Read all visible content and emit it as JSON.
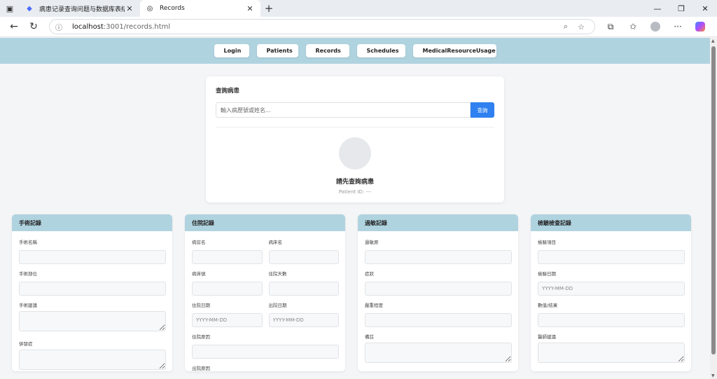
{
  "browser": {
    "tabs": [
      {
        "title": "病患记录查询问题与数据库表结构",
        "active": false,
        "icon": "deepseek-whale-icon"
      },
      {
        "title": "Records",
        "active": true,
        "icon": "globe-icon"
      }
    ],
    "url_host": "localhost",
    "url_path": ":3001/records.html"
  },
  "nav": {
    "login": "Login",
    "patients": "Patients",
    "records": "Records",
    "schedules": "Schedules",
    "medical_resource_usage": "MedicalResourceUsage"
  },
  "query": {
    "title": "查詢病患",
    "placeholder": "輸入病歷號或姓名...",
    "button": "查詢",
    "patient_name": "請先查詢病患",
    "patient_id": "Patient ID: ---"
  },
  "surgery": {
    "title": "手術記錄",
    "fields": {
      "name": "手術名稱",
      "site": "手術部位",
      "advice": "手術建議",
      "complication": "併發症"
    }
  },
  "admission": {
    "title": "住院記錄",
    "fields": {
      "ward": "病房名",
      "bed_name": "病床名",
      "bed_no": "病床號",
      "days": "住院天數",
      "admit_date": "住院日期",
      "discharge_date": "出院日期",
      "admit_reason": "住院原因",
      "discharge_reason": "出院原因"
    },
    "date_placeholder": "YYYY-MM-DD"
  },
  "allergy": {
    "title": "過敏記錄",
    "fields": {
      "allergen": "過敏原",
      "symptom": "症狀",
      "severity": "嚴重程度",
      "note": "備註"
    }
  },
  "exam": {
    "title": "檢驗檢查記錄",
    "fields": {
      "item": "檢驗項目",
      "date": "檢驗日期",
      "value": "數值/結果",
      "advice": "醫師建議"
    },
    "date_placeholder": "YYYY-MM-DD"
  },
  "colors": {
    "header_blue": "#b0d3e0",
    "primary_button": "#2f80f0"
  }
}
